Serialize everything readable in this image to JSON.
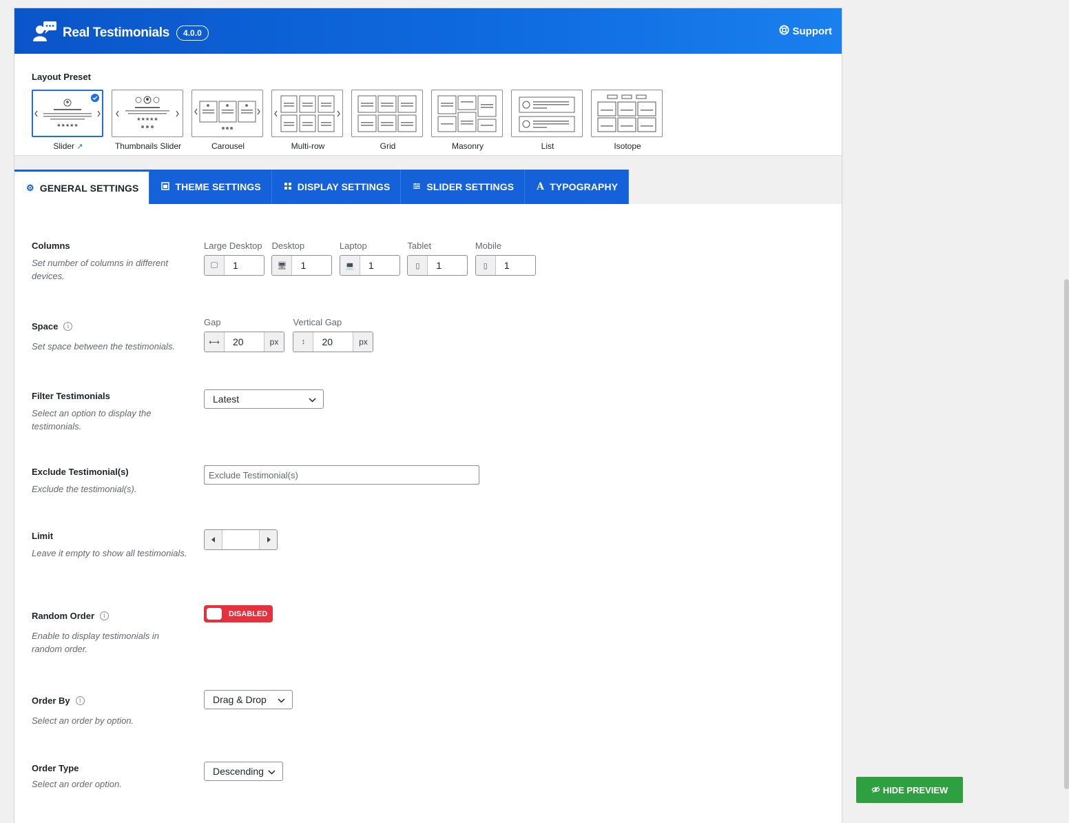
{
  "header": {
    "brand": "Real Testimonials",
    "version": "4.0.0",
    "support": "Support"
  },
  "layout_preset": {
    "title": "Layout Preset",
    "items": [
      {
        "label": "Slider",
        "selected": true
      },
      {
        "label": "Thumbnails Slider"
      },
      {
        "label": "Carousel"
      },
      {
        "label": "Multi-row"
      },
      {
        "label": "Grid"
      },
      {
        "label": "Masonry"
      },
      {
        "label": "List"
      },
      {
        "label": "Isotope"
      }
    ]
  },
  "tabs": [
    {
      "label": "GENERAL SETTINGS",
      "active": true
    },
    {
      "label": "THEME SETTINGS"
    },
    {
      "label": "DISPLAY SETTINGS"
    },
    {
      "label": "SLIDER SETTINGS"
    },
    {
      "label": "TYPOGRAPHY"
    }
  ],
  "columns": {
    "label": "Columns",
    "desc": "Set number of columns in different devices.",
    "devices": [
      {
        "label": "Large Desktop",
        "value": "1"
      },
      {
        "label": "Desktop",
        "value": "1"
      },
      {
        "label": "Laptop",
        "value": "1"
      },
      {
        "label": "Tablet",
        "value": "1"
      },
      {
        "label": "Mobile",
        "value": "1"
      }
    ]
  },
  "space": {
    "label": "Space",
    "desc": "Set space between the testimonials.",
    "gap_label": "Gap",
    "gap_value": "20",
    "vgap_label": "Vertical Gap",
    "vgap_value": "20",
    "unit": "px"
  },
  "filter": {
    "label": "Filter Testimonials",
    "desc": "Select an option to display the testimonials.",
    "value": "Latest"
  },
  "exclude": {
    "label": "Exclude Testimonial(s)",
    "desc": "Exclude the testimonial(s).",
    "placeholder": "Exclude Testimonial(s)"
  },
  "limit": {
    "label": "Limit",
    "desc": "Leave it empty to show all testimonials."
  },
  "random": {
    "label": "Random Order",
    "desc": "Enable to display testimonials in random order.",
    "state": "DISABLED"
  },
  "order_by": {
    "label": "Order By",
    "desc": "Select an order by option.",
    "value": "Drag & Drop"
  },
  "order_type": {
    "label": "Order Type",
    "desc": "Select an order option.",
    "value": "Descending"
  },
  "preview_button": "HIDE PREVIEW",
  "colors": {
    "header_blue": "#0f6be0",
    "tab_blue": "#1561d9",
    "toggle_red": "#e5313e",
    "preview_green": "#2ea03f"
  }
}
